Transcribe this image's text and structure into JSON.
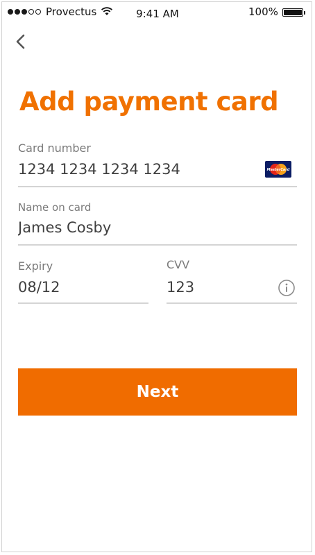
{
  "status_bar": {
    "signal_filled": 3,
    "signal_total": 5,
    "carrier": "Provectus",
    "time": "9:41 AM",
    "battery_percent": "100%",
    "battery_level": 1.0
  },
  "nav": {
    "back_icon": "chevron-left-icon"
  },
  "page": {
    "title": "Add payment card"
  },
  "form": {
    "card_number": {
      "label": "Card number",
      "value": "1234 1234 1234 1234",
      "brand": "MasterCard"
    },
    "name_on_card": {
      "label": "Name on card",
      "value": "James Cosby"
    },
    "expiry": {
      "label": "Expiry",
      "value": "08/12"
    },
    "cvv": {
      "label": "CVV",
      "value": "123",
      "info_icon": "info-icon"
    }
  },
  "actions": {
    "next_label": "Next"
  },
  "colors": {
    "accent": "#f07101",
    "button": "#f06c00",
    "divider": "#d4d4d4",
    "label": "#7a7a7a",
    "text": "#3f3f3f"
  }
}
